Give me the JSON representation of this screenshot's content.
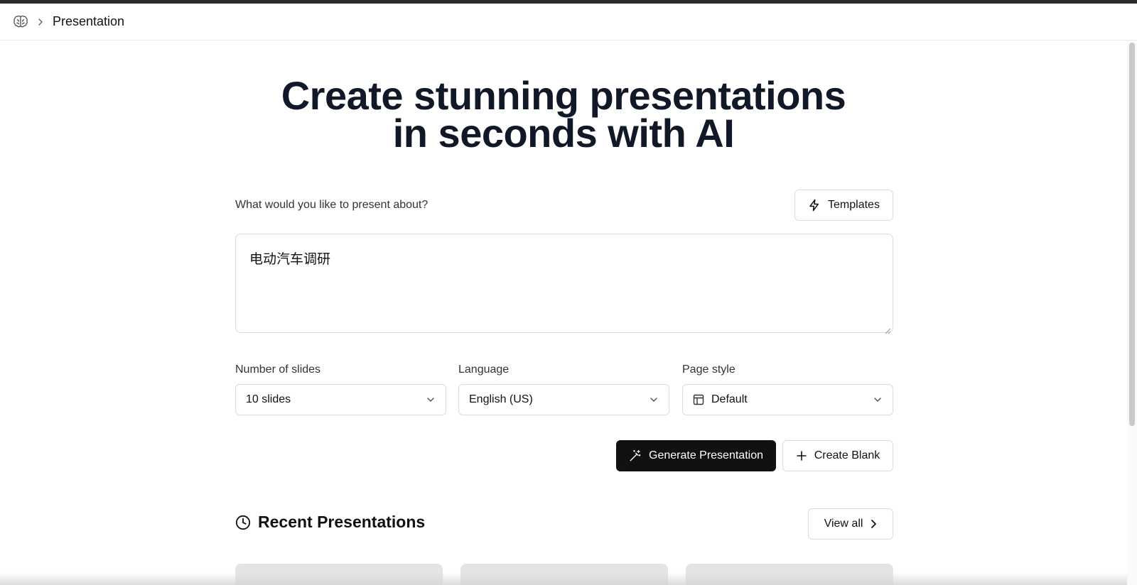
{
  "breadcrumb": {
    "home_icon": "brain-icon",
    "separator_icon": "chevron-right-icon",
    "current": "Presentation"
  },
  "hero": {
    "line1": "Create stunning presentations",
    "line2": "in seconds with AI"
  },
  "prompt": {
    "label": "What would you like to present about?",
    "value": "电动汽车调研"
  },
  "templates_button": {
    "label": "Templates",
    "icon": "lightning-icon"
  },
  "options": {
    "slides": {
      "label": "Number of slides",
      "value": "10 slides"
    },
    "language": {
      "label": "Language",
      "value": "English (US)"
    },
    "page_style": {
      "label": "Page style",
      "value": "Default",
      "icon": "layout-icon"
    }
  },
  "actions": {
    "generate": {
      "label": "Generate Presentation",
      "icon": "magic-wand-icon"
    },
    "create_blank": {
      "label": "Create Blank",
      "icon": "plus-icon"
    }
  },
  "recent": {
    "title": "Recent Presentations",
    "icon": "clock-icon",
    "view_all": "View all"
  },
  "colors": {
    "primary_button": "#111111",
    "text": "#111827",
    "border": "#dcdcdc"
  }
}
